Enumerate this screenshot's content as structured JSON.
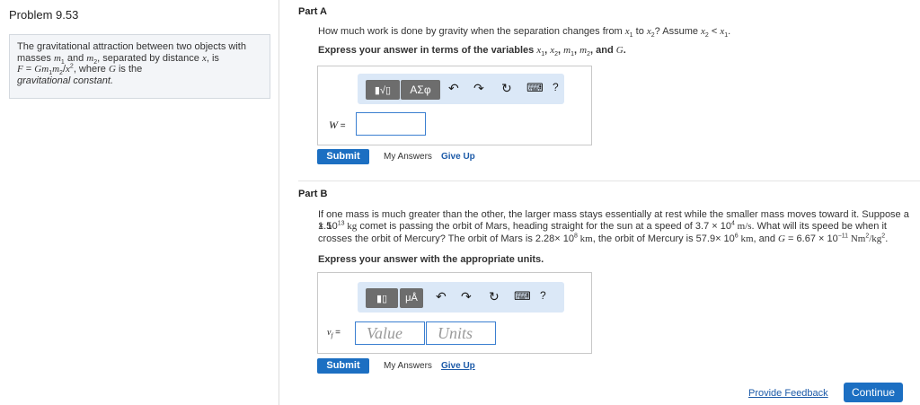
{
  "sidebar": {
    "title": "Problem 9.53",
    "intro": {
      "l1": "The gravitational attraction between two objects with",
      "l2a": "masses ",
      "m1": "m",
      "m1_sub": "1",
      "l2b": " and ",
      "m2": "m",
      "m2_sub": "2",
      "l2c": ", separated by distance ",
      "x": "x",
      "l2d": ", is",
      "formula_F": "F",
      "formula_eq": " = ",
      "formula_G": "G",
      "formula_m1": "m",
      "formula_m1_sub": "1",
      "formula_m2": "m",
      "formula_m2_sub": "2",
      "formula_slash": "/",
      "formula_x": "x",
      "formula_exp": "2",
      "l3b": ", where ",
      "G": "G",
      "l3c": " is the",
      "l4": "gravitational constant."
    }
  },
  "partA": {
    "label": "Part A",
    "question": {
      "t1": "How much work is done by gravity when the separation changes from ",
      "x": "x",
      "x1_sub": "1",
      "t2": " to ",
      "x2_sub": "2",
      "t3": "? Assume ",
      "t4": " < ",
      "t5": "."
    },
    "instruction": {
      "t1": "Express your answer in terms of the variables ",
      "x1": "x",
      "x1_sub": "1",
      "comma1": ", ",
      "x2": "x",
      "x2_sub": "2",
      "comma2": ", ",
      "m1": "m",
      "m1_sub": "1",
      "comma3": ", ",
      "m2": "m",
      "m2_sub": "2",
      "t2": ", and ",
      "G": "G",
      "t3": "."
    },
    "toolbar": {
      "templates_label": "▮√▯",
      "greek_label": "ΑΣφ",
      "undo": "↶",
      "redo": "↷",
      "reset": "↻",
      "keyboard": "⌨",
      "help": "?"
    },
    "var_label": "W",
    "var_eq": " =",
    "submit": "Submit",
    "my_answers": "My Answers",
    "give_up": "Give Up"
  },
  "partB": {
    "label": "Part B",
    "q_line1": "If one mass is much greater than the other, the larger mass stays essentially at rest while the smaller mass moves toward it. Suppose a 1.5",
    "q_line2": {
      "t1": "× 10",
      "e1": "13",
      "kg": " kg",
      "t2": " comet is passing the orbit of Mars, heading straight for the sun at a speed of 3.7 × 10",
      "e2": "4",
      "ms": " m/s",
      "t3": ". What will its speed be when it"
    },
    "q_line3": {
      "t1": "crosses the orbit of Mercury? The orbit of Mars is 2.28× 10",
      "e1": "8",
      "km1": " km",
      "t2": ", the orbit of Mercury is 57.9× 10",
      "e2": "6",
      "km2": " km",
      "t3": ", and ",
      "G": "G",
      "t4": " = 6.67 × 10",
      "e3": "−11",
      "unit": " Nm",
      "e4": "2",
      "unit2": "/kg",
      "e5": "2",
      "t5": "."
    },
    "instruction": "Express your answer with the appropriate units.",
    "toolbar": {
      "templates_label": "▮▯",
      "units_label": "μÅ",
      "undo": "↶",
      "redo": "↷",
      "reset": "↻",
      "keyboard": "⌨",
      "help": "?"
    },
    "var_label": "v",
    "var_sub": "f",
    "var_eq": " =",
    "value_placeholder": "Value",
    "units_placeholder": "Units",
    "submit": "Submit",
    "my_answers": "My Answers",
    "give_up": "Give Up"
  },
  "footer": {
    "feedback": "Provide Feedback",
    "continue": "Continue"
  }
}
